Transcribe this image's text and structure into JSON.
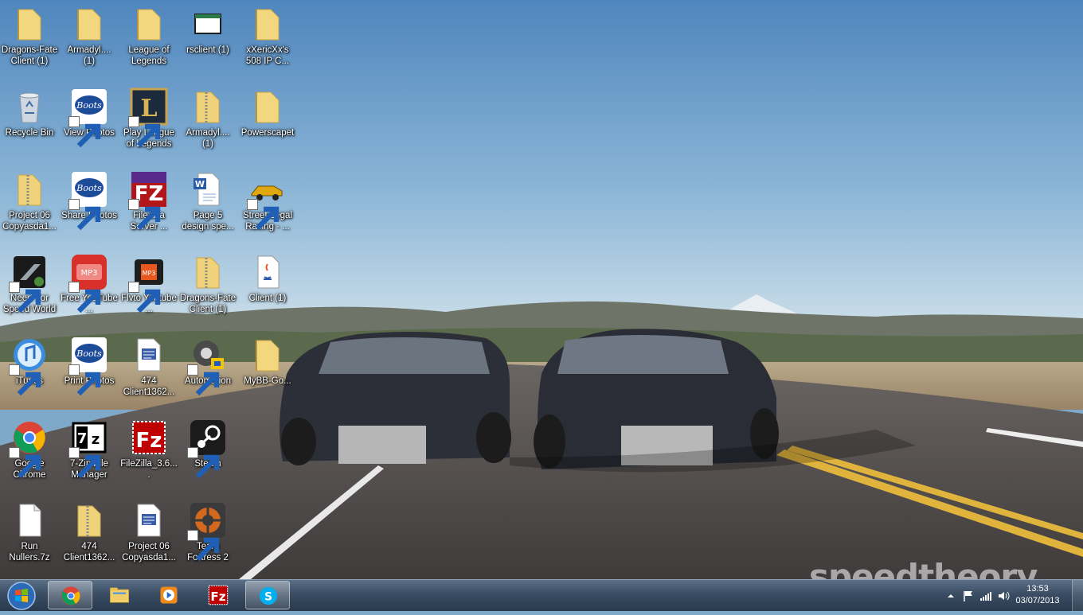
{
  "desktop": {
    "icons": [
      {
        "label": "Dragons-Fate Client (1)",
        "icon": "folder-icon"
      },
      {
        "label": "Armadyl.... (1)",
        "icon": "folder-icon"
      },
      {
        "label": "League of Legends",
        "icon": "folder-icon"
      },
      {
        "label": "rsclient (1)",
        "icon": "window-app-icon"
      },
      {
        "label": "xXericXx's 508 IP C...",
        "icon": "folder-icon"
      },
      {
        "label": "Recycle Bin",
        "icon": "recycle-bin-icon"
      },
      {
        "label": "View Photos",
        "icon": "boots-photo-icon"
      },
      {
        "label": "Play League of Legends",
        "icon": "league-of-legends-icon"
      },
      {
        "label": "Armadyl.... (1)",
        "icon": "zip-folder-icon"
      },
      {
        "label": "Powerscapet",
        "icon": "folder-icon"
      },
      {
        "label": "Project 06 Copyasda1...",
        "icon": "zip-folder-icon"
      },
      {
        "label": "Share Photos",
        "icon": "boots-photo-icon"
      },
      {
        "label": "FileZilla Server ...",
        "icon": "filezilla-server-icon"
      },
      {
        "label": "Page 5 design spe...",
        "icon": "word-document-icon"
      },
      {
        "label": "Street Legal Racing - ...",
        "icon": "racing-car-icon"
      },
      {
        "label": "Need For Speed World",
        "icon": "need-for-speed-icon"
      },
      {
        "label": "Free YouTube ...",
        "icon": "mp3-converter-icon"
      },
      {
        "label": "Flvto Youtube ...",
        "icon": "flvto-icon"
      },
      {
        "label": "Dragons-Fate Client (1)",
        "icon": "zip-folder-icon"
      },
      {
        "label": "Client (1)",
        "icon": "java-file-icon"
      },
      {
        "label": "iTunes",
        "icon": "itunes-icon"
      },
      {
        "label": "Print Photos",
        "icon": "boots-photo-icon"
      },
      {
        "label": "474 Client1362...",
        "icon": "batch-file-icon"
      },
      {
        "label": "Automation",
        "icon": "automation-gear-icon"
      },
      {
        "label": "MyBB-Go...",
        "icon": "folder-icon"
      },
      {
        "label": "Google Chrome",
        "icon": "chrome-icon"
      },
      {
        "label": "7-Zip File Manager",
        "icon": "seven-zip-icon"
      },
      {
        "label": "FileZilla_3.6....",
        "icon": "filezilla-icon"
      },
      {
        "label": "Steam",
        "icon": "steam-icon"
      },
      {
        "label": "Run Nullers.7z",
        "icon": "blank-file-icon"
      },
      {
        "label": "474 Client1362...",
        "icon": "zip-folder-icon"
      },
      {
        "label": "Project 06 Copyasda1...",
        "icon": "batch-file-icon"
      },
      {
        "label": "Team Fortress 2",
        "icon": "team-fortress-icon"
      }
    ]
  },
  "watermark": "speedtheory",
  "taskbar": {
    "start": "windows-start-icon",
    "pinned": [
      {
        "name": "chrome",
        "icon": "chrome-icon",
        "active": true
      },
      {
        "name": "explorer",
        "icon": "file-explorer-icon",
        "active": false
      },
      {
        "name": "media-player",
        "icon": "media-player-icon",
        "active": false
      },
      {
        "name": "filezilla",
        "icon": "filezilla-icon",
        "active": false
      },
      {
        "name": "skype",
        "icon": "skype-icon",
        "active": true
      }
    ],
    "tray": {
      "icons": [
        "show-hidden-icons-arrow-icon",
        "action-center-flag-icon",
        "network-signal-icon",
        "volume-icon"
      ],
      "time": "13:53",
      "date": "03/07/2013"
    }
  },
  "colors": {
    "folder": "#e9c86a",
    "taskbar": "#34475c",
    "sky": "#5f93c3",
    "road": "#4d4a4a"
  }
}
